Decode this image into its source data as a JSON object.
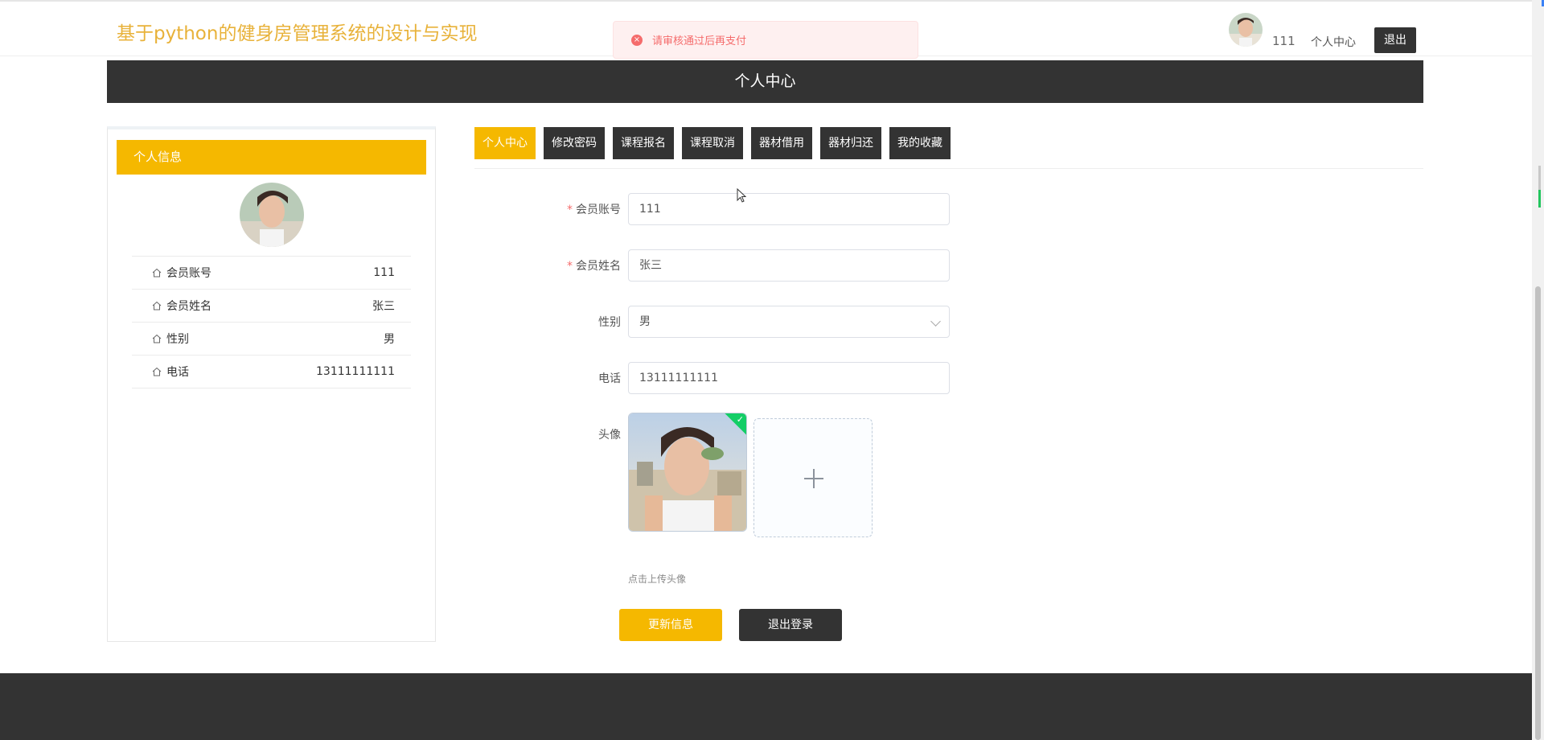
{
  "header": {
    "site_title": "基于python的健身房管理系统的设计与实现",
    "username": "111",
    "center_link": "个人中心",
    "logout_label": "退出"
  },
  "toast": {
    "message": "请审核通过后再支付",
    "icon": "error-icon",
    "color": "#f56c6c"
  },
  "banner": {
    "title": "个人中心"
  },
  "card": {
    "heading": "个人信息",
    "rows": [
      {
        "label": "会员账号",
        "value": "111"
      },
      {
        "label": "会员姓名",
        "value": "张三"
      },
      {
        "label": "性别",
        "value": "男"
      },
      {
        "label": "电话",
        "value": "13111111111"
      }
    ]
  },
  "tabs": [
    {
      "label": "个人中心",
      "active": true
    },
    {
      "label": "修改密码",
      "active": false
    },
    {
      "label": "课程报名",
      "active": false
    },
    {
      "label": "课程取消",
      "active": false
    },
    {
      "label": "器材借用",
      "active": false
    },
    {
      "label": "器材归还",
      "active": false
    },
    {
      "label": "我的收藏",
      "active": false
    }
  ],
  "form": {
    "account": {
      "label": "会员账号",
      "value": "111",
      "required": true
    },
    "name": {
      "label": "会员姓名",
      "value": "张三",
      "required": true
    },
    "gender": {
      "label": "性别",
      "value": "男"
    },
    "phone": {
      "label": "电话",
      "value": "13111111111"
    },
    "avatar": {
      "label": "头像",
      "tip": "点击上传头像"
    }
  },
  "buttons": {
    "update": "更新信息",
    "logout": "退出登录"
  },
  "colors": {
    "accent": "#f5b800",
    "dark": "#333333",
    "title": "#e8b23a",
    "success": "#13ce66"
  }
}
